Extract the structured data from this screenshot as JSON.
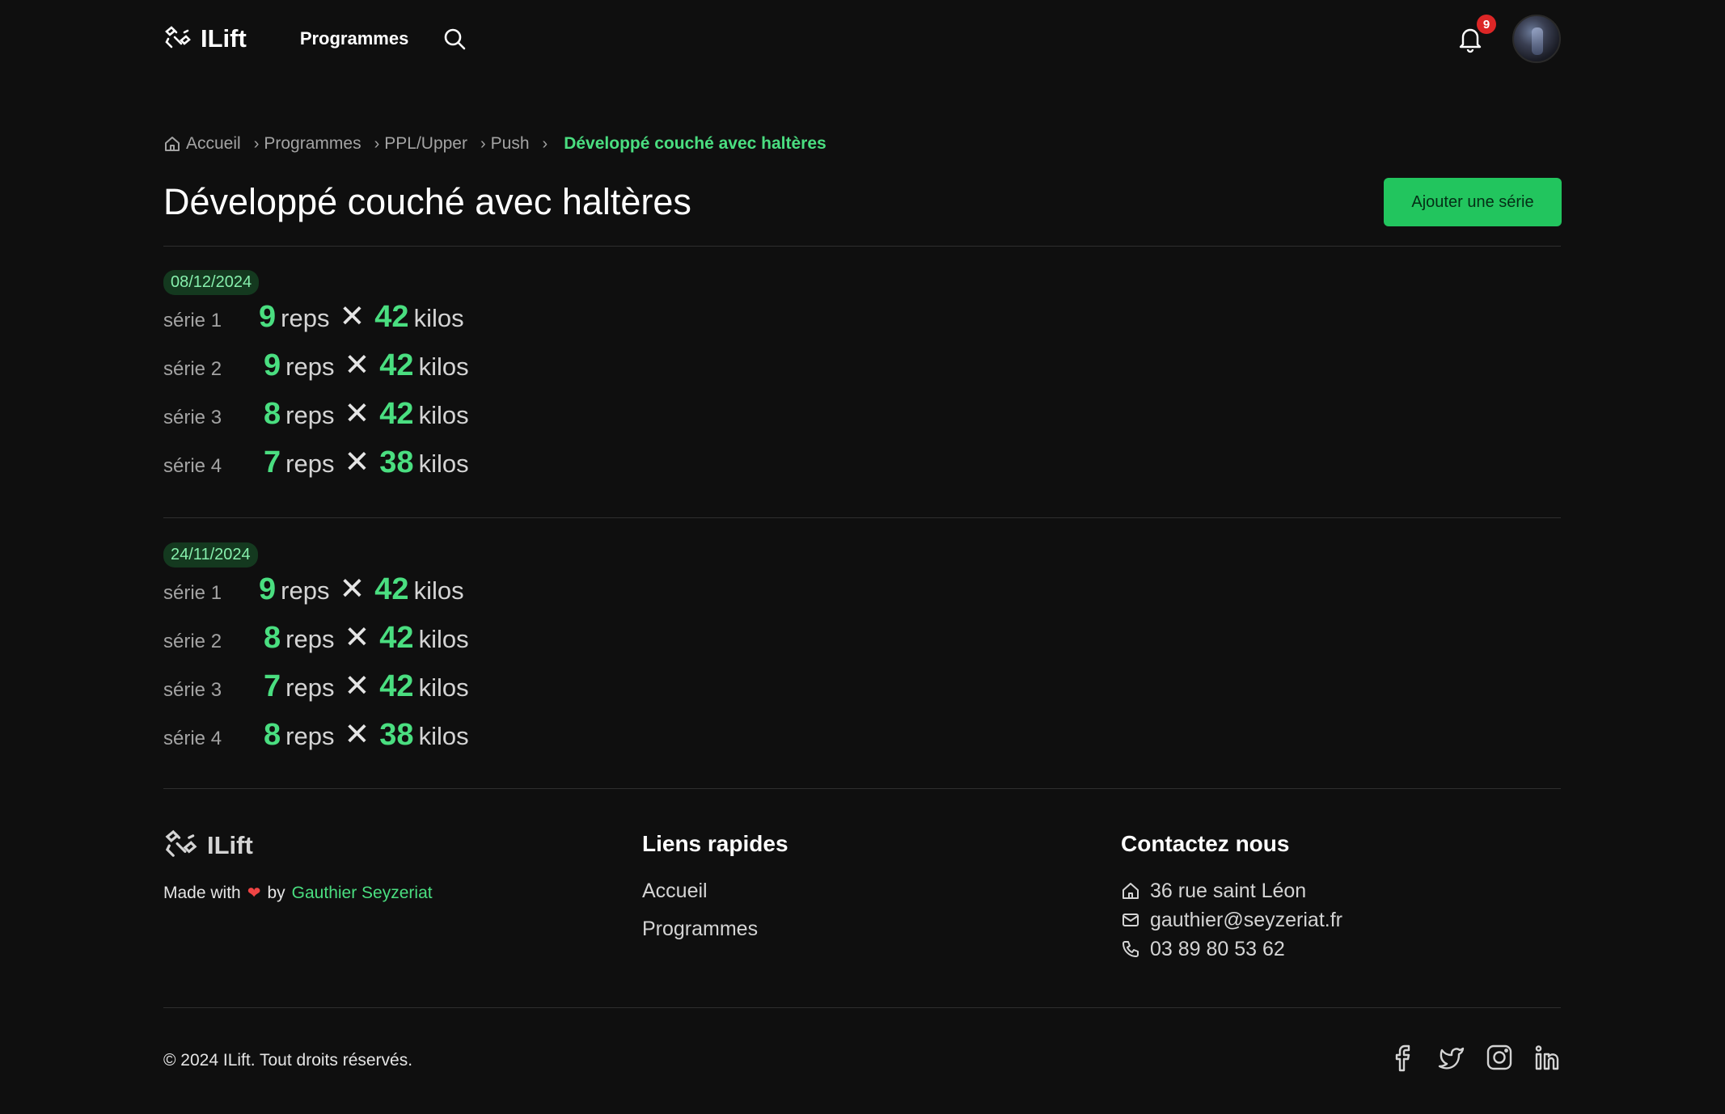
{
  "header": {
    "brand": "ILift",
    "nav_programmes": "Programmes",
    "notification_count": "9"
  },
  "breadcrumb": {
    "items": [
      "Accueil",
      "Programmes",
      "PPL/Upper",
      "Push"
    ],
    "current": "Développé couché avec haltères"
  },
  "page": {
    "title": "Développé couché avec haltères",
    "add_button": "Ajouter une série"
  },
  "labels": {
    "reps": "reps",
    "kilos": "kilos",
    "times": "✕"
  },
  "sessions": [
    {
      "date": "08/12/2024",
      "series": [
        {
          "label": "série 1",
          "reps": "9",
          "kilos": "42"
        },
        {
          "label": "série 2",
          "reps": "9",
          "kilos": "42"
        },
        {
          "label": "série 3",
          "reps": "8",
          "kilos": "42"
        },
        {
          "label": "série 4",
          "reps": "7",
          "kilos": "38"
        }
      ]
    },
    {
      "date": "24/11/2024",
      "series": [
        {
          "label": "série 1",
          "reps": "9",
          "kilos": "42"
        },
        {
          "label": "série 2",
          "reps": "8",
          "kilos": "42"
        },
        {
          "label": "série 3",
          "reps": "7",
          "kilos": "42"
        },
        {
          "label": "série 4",
          "reps": "8",
          "kilos": "38"
        }
      ]
    }
  ],
  "footer": {
    "brand": "ILift",
    "made_with": "Made with",
    "by": "by",
    "author": "Gauthier Seyzeriat",
    "quick_links_title": "Liens rapides",
    "quick_links": [
      "Accueil",
      "Programmes"
    ],
    "contact_title": "Contactez nous",
    "address": "36 rue saint Léon",
    "email": "gauthier@seyzeriat.fr",
    "phone": "03 89 80 53 62",
    "copyright": "© 2024 ILift. Tout droits réservés."
  },
  "icons": [
    "logo-icon",
    "search-icon",
    "bell-icon",
    "home-icon",
    "mail-icon",
    "phone-icon",
    "heart-icon",
    "facebook-icon",
    "twitter-icon",
    "instagram-icon",
    "linkedin-icon"
  ],
  "colors": {
    "accent": "#22c55e",
    "accent_text": "#4ade80",
    "background": "#0f0f0f",
    "badge": "#dc2626"
  }
}
